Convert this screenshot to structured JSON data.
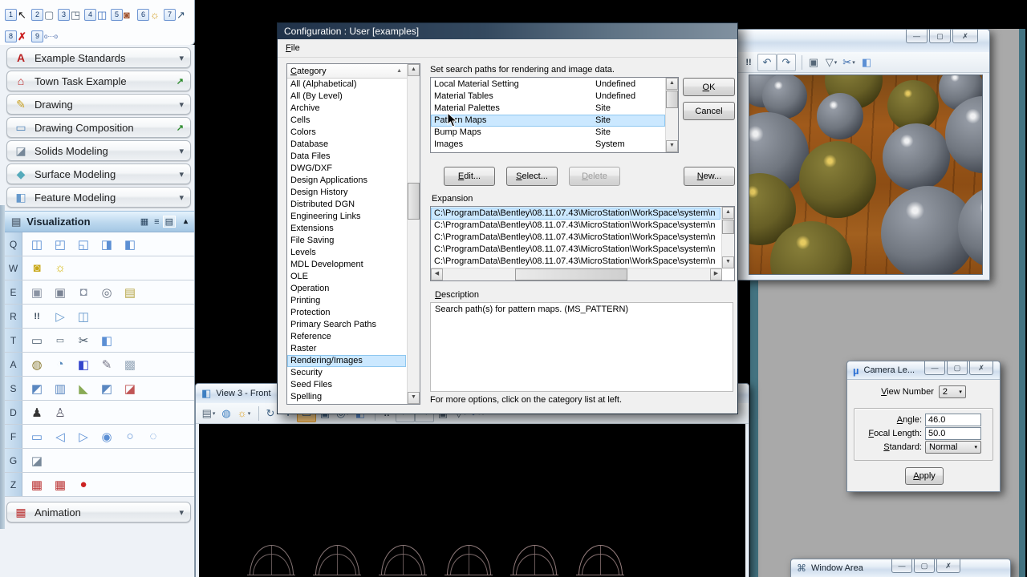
{
  "chrome": {
    "min": "—",
    "restore": "▢",
    "close": "✗"
  },
  "top_toolbar": {
    "row1": [
      {
        "num": "1",
        "glyph": "↖",
        "istyle": "color:#111111",
        "name": "element-selection-icon"
      },
      {
        "num": "2",
        "glyph": "▢",
        "istyle": "color:#667788",
        "name": "fence-icon"
      },
      {
        "num": "3",
        "glyph": "◳",
        "istyle": "color:#556677",
        "name": "drop-element-icon"
      },
      {
        "num": "4",
        "glyph": "◫",
        "istyle": "color:#3b6fbe",
        "name": "models-icon"
      },
      {
        "num": "5",
        "glyph": "◙",
        "istyle": "color:#a0522d",
        "name": "color-palette-icon"
      },
      {
        "num": "6",
        "glyph": "☼",
        "istyle": "color:#d19b1e",
        "name": "light-icon"
      },
      {
        "num": "7",
        "glyph": "↗",
        "istyle": "color:#335577",
        "name": "change-view-icon"
      }
    ],
    "row2": [
      {
        "num": "8",
        "glyph": "✗",
        "istyle": "color:#cc2222;font-weight:bold",
        "name": "delete-element-icon"
      },
      {
        "num": "9",
        "glyph": "o⋯o",
        "istyle": "color:#4466aa;font-size:8px",
        "name": "measure-icon"
      }
    ]
  },
  "task_pane": {
    "sections": [
      {
        "label": "Example Standards",
        "glyph": "A",
        "istyle": "color:#bb2222;font-weight:bold",
        "right": "▾",
        "rstyle": "color:#4a5562",
        "name": "section-example-standards"
      },
      {
        "label": "Town Task Example",
        "glyph": "⌂",
        "istyle": "color:#bb2222",
        "right": "↗",
        "rstyle": "color:#2a8a2a;font-weight:bold",
        "name": "section-town-task-example"
      },
      {
        "label": "Drawing",
        "glyph": "✎",
        "istyle": "color:#c8a020",
        "right": "▾",
        "rstyle": "color:#4a5562",
        "name": "section-drawing"
      },
      {
        "label": "Drawing Composition",
        "glyph": "▭",
        "istyle": "color:#5588bb",
        "right": "↗",
        "rstyle": "color:#2a8a2a;font-weight:bold",
        "name": "section-drawing-composition"
      },
      {
        "label": "Solids Modeling",
        "glyph": "◪",
        "istyle": "color:#778899",
        "right": "▾",
        "rstyle": "color:#4a5562",
        "name": "section-solids-modeling"
      },
      {
        "label": "Surface Modeling",
        "glyph": "◆",
        "istyle": "color:#55aabb",
        "right": "▾",
        "rstyle": "color:#4a5562",
        "name": "section-surface-modeling"
      },
      {
        "label": "Feature Modeling",
        "glyph": "◧",
        "istyle": "color:#6699cc",
        "right": "▾",
        "rstyle": "color:#4a5562",
        "name": "section-feature-modeling"
      }
    ],
    "visualization": {
      "label": "Visualization",
      "glyph": "▤",
      "istyle": "color:#667788",
      "view_icons": [
        {
          "glyph": "▦",
          "name": "icon-view-grid"
        },
        {
          "glyph": "≡",
          "name": "icon-view-list"
        },
        {
          "glyph": "▤",
          "name": "icon-view-stacked",
          "sel": "1"
        }
      ],
      "chevron": "▴"
    },
    "tool_rows": [
      {
        "key": "Q",
        "icons": [
          {
            "glyph": "◫",
            "istyle": "color:#5b8fd4",
            "name": "place-slab-icon"
          },
          {
            "glyph": "◰",
            "istyle": "color:#5b8fd4",
            "name": "place-sphere-icon"
          },
          {
            "glyph": "◱",
            "istyle": "color:#5b8fd4",
            "name": "place-cylinder-icon"
          },
          {
            "glyph": "◨",
            "istyle": "color:#5b8fd4",
            "name": "place-cone-icon"
          },
          {
            "glyph": "◧",
            "istyle": "color:#5b8fd4",
            "name": "place-torus-icon"
          }
        ]
      },
      {
        "key": "W",
        "icons": [
          {
            "glyph": "◙",
            "istyle": "color:#c9a818",
            "name": "define-light-icon"
          },
          {
            "glyph": "☼",
            "istyle": "color:#d4b400",
            "name": "place-light-icon"
          }
        ]
      },
      {
        "key": "E",
        "icons": [
          {
            "glyph": "▣",
            "istyle": "color:#8a93a3",
            "name": "define-camera-icon"
          },
          {
            "glyph": "▣",
            "istyle": "color:#7a8393",
            "name": "camera-settings-icon"
          },
          {
            "glyph": "◘",
            "istyle": "color:#8a93a3",
            "name": "camera-selection-icon"
          },
          {
            "glyph": "◎",
            "istyle": "color:#6a7383",
            "name": "camera-lens-icon"
          },
          {
            "glyph": "▤",
            "istyle": "color:#b8a84a",
            "name": "camera-measure-icon"
          }
        ]
      },
      {
        "key": "R",
        "icons": [
          {
            "glyph": "!!",
            "istyle": "color:#334455;font-weight:bold;font-size:11px",
            "name": "render-flags-icon"
          },
          {
            "glyph": "▷",
            "istyle": "color:#6699cc",
            "name": "paper-plane-icon"
          },
          {
            "glyph": "◫",
            "istyle": "color:#6699cc",
            "name": "render-window-icon"
          }
        ]
      },
      {
        "key": "T",
        "icons": [
          {
            "glyph": "▭",
            "istyle": "color:#556677",
            "name": "fence-rect-icon"
          },
          {
            "glyph": "▭",
            "istyle": "color:#556677;font-size:11px",
            "name": "small-rect-icon"
          },
          {
            "glyph": "✂",
            "istyle": "color:#445566",
            "name": "clip-cube-icon"
          },
          {
            "glyph": "◧",
            "istyle": "color:#5b8fd4",
            "name": "cube-clip-icon"
          }
        ]
      },
      {
        "key": "A",
        "icons": [
          {
            "glyph": "◍",
            "istyle": "color:#8a7a30",
            "name": "material-can-icon"
          },
          {
            "glyph": "◔",
            "istyle": "color:#5588bb",
            "name": "apply-material-icon"
          },
          {
            "glyph": "◧",
            "istyle": "color:#3344cc",
            "name": "assign-material-icon"
          },
          {
            "glyph": "✎",
            "istyle": "color:#777788",
            "name": "query-material-icon"
          },
          {
            "glyph": "▩",
            "istyle": "color:#99aabb",
            "name": "freeze-material-icon"
          }
        ]
      },
      {
        "key": "S",
        "icons": [
          {
            "glyph": "◩",
            "istyle": "color:#5a87c0",
            "name": "setup-view-icon"
          },
          {
            "glyph": "▥",
            "istyle": "color:#5a87c0",
            "name": "setup-list-icon"
          },
          {
            "glyph": "◣",
            "istyle": "color:#88aa55",
            "name": "axis-icon"
          },
          {
            "glyph": "◩",
            "istyle": "color:#5a87c0",
            "name": "setup-multi-icon"
          },
          {
            "glyph": "◪",
            "istyle": "color:#c05555",
            "name": "delete-setup-icon"
          }
        ]
      },
      {
        "key": "D",
        "icons": [
          {
            "glyph": "♟",
            "istyle": "color:#333333",
            "name": "walk-icon"
          },
          {
            "glyph": "♙",
            "istyle": "color:#555566",
            "name": "navigate-icon"
          }
        ]
      },
      {
        "key": "F",
        "icons": [
          {
            "glyph": "▭",
            "istyle": "color:#5b8fd4",
            "name": "place-shape-rect-icon"
          },
          {
            "glyph": "◁",
            "istyle": "color:#5b8fd4",
            "name": "place-shape-poly-icon"
          },
          {
            "glyph": "▷",
            "istyle": "color:#5b8fd4",
            "name": "place-shape-arrow-icon"
          },
          {
            "glyph": "◉",
            "istyle": "color:#5b8fd4",
            "name": "place-shape-octagon-icon"
          },
          {
            "glyph": "○",
            "istyle": "color:#5b8fd4",
            "name": "place-shape-circle-icon"
          },
          {
            "glyph": "◌",
            "istyle": "color:#5b8fd4",
            "name": "place-shape-ellipse-icon"
          }
        ]
      },
      {
        "key": "G",
        "icons": [
          {
            "glyph": "◪",
            "istyle": "color:#778899",
            "name": "sheet-icon"
          }
        ]
      },
      {
        "key": "Z",
        "icons": [
          {
            "glyph": "▦",
            "istyle": "color:#bb3333",
            "name": "film-icon"
          },
          {
            "glyph": "▦",
            "istyle": "color:#bb3333",
            "name": "film-preview-icon"
          },
          {
            "glyph": "●",
            "istyle": "color:#cc2222",
            "name": "record-icon"
          }
        ]
      }
    ],
    "animation": {
      "label": "Animation",
      "glyph": "▦",
      "istyle": "color:#bb3333",
      "chevron": "▾"
    }
  },
  "config_dialog": {
    "title": "Configuration : User [examples]",
    "menu": {
      "file": "File"
    },
    "category": {
      "header": "Category",
      "sort": "▲",
      "items": [
        {
          "label": "All (Alphabetical)"
        },
        {
          "label": "All (By Level)"
        },
        {
          "label": "Archive"
        },
        {
          "label": "Cells"
        },
        {
          "label": "Colors"
        },
        {
          "label": "Database"
        },
        {
          "label": "Data Files"
        },
        {
          "label": "DWG/DXF"
        },
        {
          "label": "Design Applications"
        },
        {
          "label": "Design History"
        },
        {
          "label": "Distributed DGN"
        },
        {
          "label": "Engineering Links"
        },
        {
          "label": "Extensions"
        },
        {
          "label": "File Saving"
        },
        {
          "label": "Levels"
        },
        {
          "label": "MDL Development"
        },
        {
          "label": "OLE"
        },
        {
          "label": "Operation"
        },
        {
          "label": "Printing"
        },
        {
          "label": "Protection"
        },
        {
          "label": "Primary Search Paths"
        },
        {
          "label": "Reference"
        },
        {
          "label": "Raster"
        },
        {
          "label": "Rendering/Images",
          "sel": "1"
        },
        {
          "label": "Security"
        },
        {
          "label": "Seed Files"
        },
        {
          "label": "Spelling"
        }
      ]
    },
    "prompt": "Set search paths for rendering and image data.",
    "paths": {
      "rows": [
        {
          "name": "Local Material Setting",
          "value": "Undefined"
        },
        {
          "name": "Material Tables",
          "value": "Undefined"
        },
        {
          "name": "Material Palettes",
          "value": "Site"
        },
        {
          "name": "Pattern Maps",
          "value": "Site",
          "sel": "1"
        },
        {
          "name": "Bump Maps",
          "value": "Site"
        },
        {
          "name": "Images",
          "value": "System"
        }
      ]
    },
    "actions": {
      "ok": "OK",
      "cancel": "Cancel",
      "edit": "Edit...",
      "select": "Select...",
      "delete": "Delete",
      "new": "New..."
    },
    "expansion": {
      "label": "Expansion",
      "rows": [
        {
          "text": "C:\\ProgramData\\Bentley\\08.11.07.43\\MicroStation\\WorkSpace\\system\\n",
          "sel": "1"
        },
        {
          "text": "C:\\ProgramData\\Bentley\\08.11.07.43\\MicroStation\\WorkSpace\\system\\n"
        },
        {
          "text": "C:\\ProgramData\\Bentley\\08.11.07.43\\MicroStation\\WorkSpace\\system\\n"
        },
        {
          "text": "C:\\ProgramData\\Bentley\\08.11.07.43\\MicroStation\\WorkSpace\\system\\n"
        },
        {
          "text": "C:\\ProgramData\\Bentley\\08.11.07.43\\MicroStation\\WorkSpace\\system\\n"
        }
      ]
    },
    "description": {
      "label": "Description",
      "text": "Search path(s) for pattern maps.  (MS_PATTERN)"
    },
    "footer": "For more options, click on the category list at left."
  },
  "render_window": {
    "toolbar": [
      {
        "glyph": "!!",
        "name": "view-flags-icon",
        "istyle": "color:#334455;font-weight:bold;font-size:11px"
      },
      {
        "glyph": "↶",
        "name": "undo-view-icon",
        "istyle": "color:#446688",
        "mods": "btn"
      },
      {
        "glyph": "↷",
        "name": "redo-view-icon",
        "istyle": "color:#446688",
        "mods": "btn"
      },
      {
        "glyph": "",
        "name": "separator",
        "mods": "sep"
      },
      {
        "glyph": "▣",
        "name": "copy-view-icon",
        "istyle": "color:#556677"
      },
      {
        "glyph": "▽",
        "name": "render-mode-icon",
        "istyle": "color:#556677",
        "mods": "dd"
      },
      {
        "glyph": "✂",
        "name": "clip-volume-icon",
        "istyle": "color:#3366aa",
        "mods": "dd"
      },
      {
        "glyph": "◧",
        "name": "clip-mask-icon",
        "istyle": "color:#5b8fd4"
      }
    ],
    "spheres": [
      {
        "kind": "gray",
        "style": "left:-14px;top:-22px;width:62px;height:62px"
      },
      {
        "kind": "gray",
        "style": "left:16px;top:-2px;width:56px;height:56px"
      },
      {
        "kind": "olive",
        "style": "left:94px;top:-30px;width:72px;height:72px"
      },
      {
        "kind": "gray",
        "style": "left:84px;top:22px;width:58px;height:58px"
      },
      {
        "kind": "olive",
        "style": "left:172px;top:6px;width:64px;height:64px"
      },
      {
        "kind": "gray",
        "style": "left:236px;top:-12px;width:56px;height:56px"
      },
      {
        "kind": "gray",
        "style": "left:-30px;top:46px;width:104px;height:104px"
      },
      {
        "kind": "gray",
        "style": "left:166px;top:60px;width:84px;height:84px"
      },
      {
        "kind": "gray",
        "style": "left:244px;top:26px;width:96px;height:96px"
      },
      {
        "kind": "olive",
        "style": "left:62px;top:82px;width:96px;height:96px"
      },
      {
        "kind": "olive",
        "style": "left:-32px;top:122px;width:90px;height:90px"
      },
      {
        "kind": "gray",
        "style": "left:164px;top:138px;width:118px;height:118px"
      },
      {
        "kind": "olive",
        "style": "left:26px;top:182px;width:102px;height:102px"
      },
      {
        "kind": "gray",
        "style": "left:260px;top:138px;width:104px;height:104px"
      }
    ]
  },
  "view3_window": {
    "title": "View 3 - Front",
    "icon_glyph": "◧",
    "toolbar": [
      {
        "glyph": "▤",
        "name": "view-attributes-icon",
        "istyle": "color:#556677",
        "mods": "dd"
      },
      {
        "glyph": "◍",
        "name": "display-style-icon",
        "istyle": "color:#3e7fc1"
      },
      {
        "glyph": "☼",
        "name": "adjust-brightness-icon",
        "istyle": "color:#e0a428",
        "mods": "dd"
      },
      {
        "glyph": "",
        "name": "separator",
        "mods": "sep"
      },
      {
        "glyph": "↻",
        "name": "rotate-view-icon",
        "istyle": "color:#446688"
      },
      {
        "glyph": "+",
        "name": "pan-view-icon",
        "istyle": "color:#446688;font-weight:bold"
      },
      {
        "glyph": "▭",
        "name": "window-area-icon",
        "istyle": "color:#446688",
        "mods": "active"
      },
      {
        "glyph": "▣",
        "name": "fit-view-icon",
        "istyle": "color:#446688"
      },
      {
        "glyph": "◎",
        "name": "view-orientation-icon",
        "istyle": "color:#446688",
        "mods": "dd"
      },
      {
        "glyph": "◧",
        "name": "view-cube-icon",
        "istyle": "color:#5b8fd4"
      },
      {
        "glyph": "",
        "name": "separator",
        "mods": "sep"
      },
      {
        "glyph": "!!",
        "name": "view-flags-icon",
        "istyle": "color:#334455;font-weight:bold;font-size:11px"
      },
      {
        "glyph": "↶",
        "name": "undo-view-icon",
        "istyle": "color:#446688",
        "mods": "btn"
      },
      {
        "glyph": "↷",
        "name": "redo-view-icon",
        "istyle": "color:#446688",
        "mods": "btn"
      },
      {
        "glyph": "▣",
        "name": "copy-view-icon",
        "istyle": "color:#556677"
      },
      {
        "glyph": "▽",
        "name": "render-mode-icon",
        "istyle": "color:#556677",
        "mods": "dd"
      },
      {
        "glyph": "✂",
        "name": "clip-volume-icon",
        "istyle": "color:#3366aa",
        "mods": "dd"
      }
    ],
    "domes": [
      {
        "style": "left:63px;top:151px;color:#837373"
      },
      {
        "style": "left:145px;top:151px;color:#877575"
      },
      {
        "style": "left:227px;top:151px;color:#8b7878"
      },
      {
        "style": "left:309px;top:151px;color:#8f7a7a"
      },
      {
        "style": "left:391px;top:151px;color:#937c7c"
      },
      {
        "style": "left:473px;top:151px;color:#987f7f"
      }
    ]
  },
  "camera_dialog": {
    "title": "Camera Le...",
    "logo": "µ",
    "view_number_label": "View Number",
    "view_number": "2",
    "dd_arrow": "▾",
    "fields": [
      {
        "label": "Angle:",
        "value": "46.0"
      },
      {
        "label": "Focal Length:",
        "value": "50.0"
      }
    ],
    "standard_label": "Standard:",
    "standard_value": "Normal",
    "apply": "Apply"
  },
  "window_area_dialog": {
    "title": "Window Area",
    "glyph": "⌘"
  }
}
